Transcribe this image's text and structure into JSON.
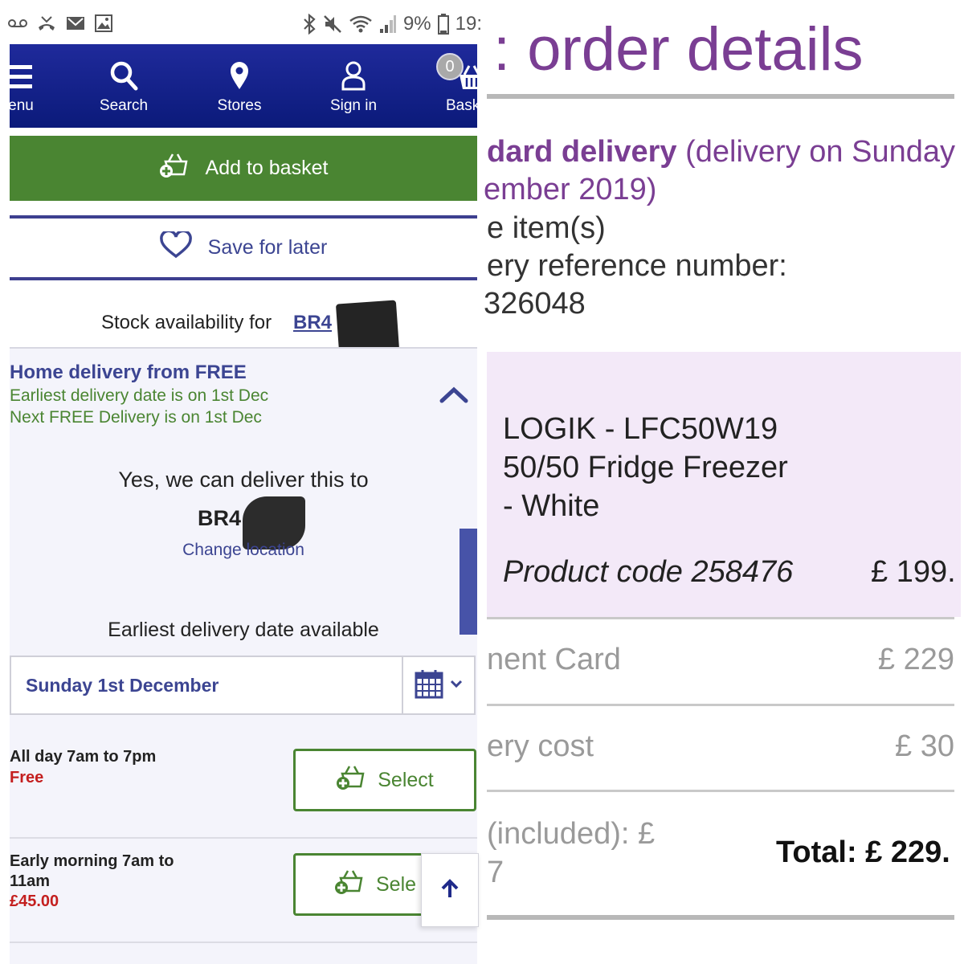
{
  "status_bar": {
    "battery": "9%",
    "time": "19:"
  },
  "nav": {
    "items": [
      {
        "label": "enu",
        "icon": "menu-icon"
      },
      {
        "label": "Search",
        "icon": "search-icon"
      },
      {
        "label": "Stores",
        "icon": "location-pin-icon"
      },
      {
        "label": "Sign in",
        "icon": "user-icon"
      },
      {
        "label": "Bask",
        "icon": "basket-icon"
      }
    ],
    "basket_count": "0"
  },
  "product_actions": {
    "add_to_basket": "Add to basket",
    "save_for_later": "Save for later"
  },
  "stock": {
    "label": "Stock availability for ",
    "postcode": "BR4"
  },
  "home_delivery": {
    "title": "Home delivery from FREE",
    "earliest": "Earliest delivery date is on 1st Dec",
    "next_free": "Next FREE Delivery is on 1st Dec",
    "can_deliver": "Yes, we can deliver this to",
    "postcode": "BR4",
    "change_location": "Change location",
    "earliest_heading": "Earliest delivery date available",
    "selected_date": "Sunday 1st December"
  },
  "slots": [
    {
      "name": "All day 7am to 7pm",
      "price": "Free",
      "button": "Select"
    },
    {
      "name": "Early morning 7am to 11am",
      "price": "£45.00",
      "button": "Sele"
    }
  ],
  "colors": {
    "nav_blue": "#0b1a7a",
    "action_green": "#4a8532",
    "link_blue": "#3c4592",
    "price_red": "#c41f1f",
    "title_purple": "#7a3e93",
    "product_bg": "#f3e9f8"
  },
  "order": {
    "title": "order details",
    "delivery_bold": "dard delivery",
    "delivery_paren": " (delivery on Sunday",
    "delivery_line2": "ember 2019)",
    "items_line": "e item(s)",
    "ref_label": "ery reference number:",
    "ref_value": "326048",
    "product_name": [
      "LOGIK - LFC50W19",
      "50/50 Fridge Freezer",
      "- White"
    ],
    "product_code": "Product code 258476",
    "product_price": "£ 199.",
    "payment_label": "nent Card",
    "payment_value": "£ 229",
    "delivery_cost_label": "ery cost",
    "delivery_cost_value": "£ 30",
    "vat_line1": "(included): £",
    "vat_line2": "7",
    "total": "Total: £ 229."
  }
}
